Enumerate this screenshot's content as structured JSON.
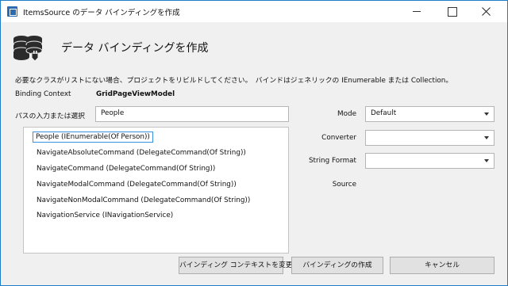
{
  "window": {
    "title": "ItemsSource のデータ バインディングを作成"
  },
  "header": {
    "heading": "データ バインディングを作成",
    "description": "必要なクラスがリストにない場合、プロジェクトをリビルドしてください。　バインドはジェネリックの IEnumerable または Collection。"
  },
  "binding_context": {
    "label": "Binding Context",
    "value": "GridPageViewModel"
  },
  "path": {
    "label": "パスの入力または選択",
    "value": "People"
  },
  "list": {
    "items": [
      "People (IEnumerable(Of Person))",
      "NavigateAbsoluteCommand (DelegateCommand(Of String))",
      "NavigateCommand (DelegateCommand(Of String))",
      "NavigateModalCommand (DelegateCommand(Of String))",
      "NavigateNonModalCommand (DelegateCommand(Of String))",
      "NavigationService (INavigationService)"
    ],
    "selected_index": 0
  },
  "options": {
    "mode_label": "Mode",
    "mode_value": "Default",
    "converter_label": "Converter",
    "converter_value": "",
    "string_format_label": "String Format",
    "string_format_value": "",
    "source_label": "Source"
  },
  "buttons": {
    "change_context": "バインディング コンテキストを変更",
    "create": "バインディングの作成",
    "cancel": "キャンセル"
  },
  "colors": {
    "accent": "#1e7cc8",
    "selection_border": "#3c8ee0"
  }
}
